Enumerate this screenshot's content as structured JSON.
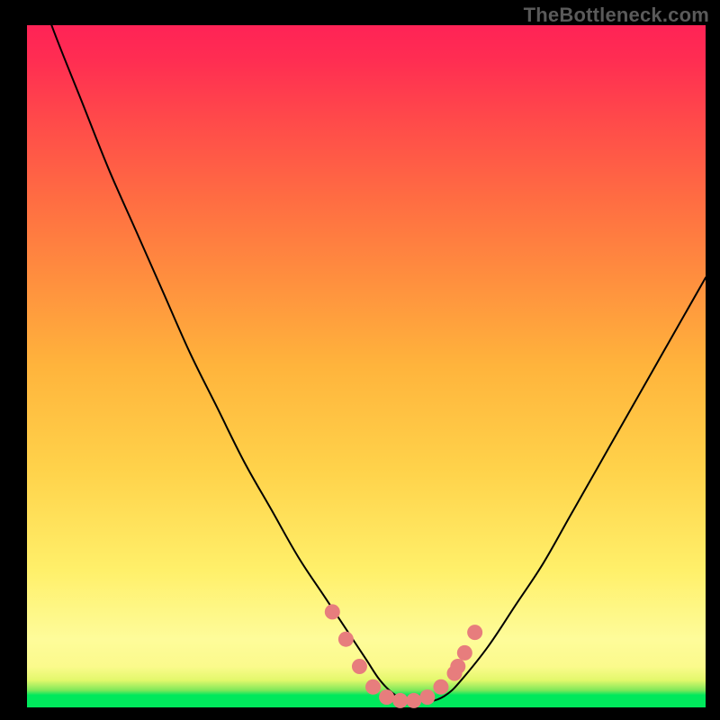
{
  "watermark": "TheBottleneck.com",
  "chart_data": {
    "type": "line",
    "title": "",
    "xlabel": "",
    "ylabel": "",
    "xlim": [
      0,
      100
    ],
    "ylim": [
      0,
      100
    ],
    "series": [
      {
        "name": "bottleneck-curve",
        "x": [
          0,
          4,
          8,
          12,
          16,
          20,
          24,
          28,
          32,
          36,
          40,
          44,
          48,
          50,
          52,
          54,
          56,
          58,
          60,
          62,
          64,
          68,
          72,
          76,
          80,
          84,
          88,
          92,
          96,
          100
        ],
        "values": [
          110,
          99,
          89,
          79,
          70,
          61,
          52,
          44,
          36,
          29,
          22,
          16,
          10,
          7,
          4,
          2,
          1,
          1,
          1,
          2,
          4,
          9,
          15,
          21,
          28,
          35,
          42,
          49,
          56,
          63
        ]
      }
    ],
    "markers": {
      "name": "highlight-dots",
      "color": "#e77d7d",
      "x": [
        45,
        47,
        49,
        51,
        53,
        55,
        57,
        59,
        61,
        63,
        63.5,
        64.5,
        66
      ],
      "values": [
        14,
        10,
        6,
        3,
        1.5,
        1,
        1,
        1.5,
        3,
        5,
        6,
        8,
        11
      ]
    },
    "gradient_scale": {
      "bottom_color": "#00e85c",
      "mid_color": "#ffd24a",
      "top_color": "#ff2356"
    }
  }
}
